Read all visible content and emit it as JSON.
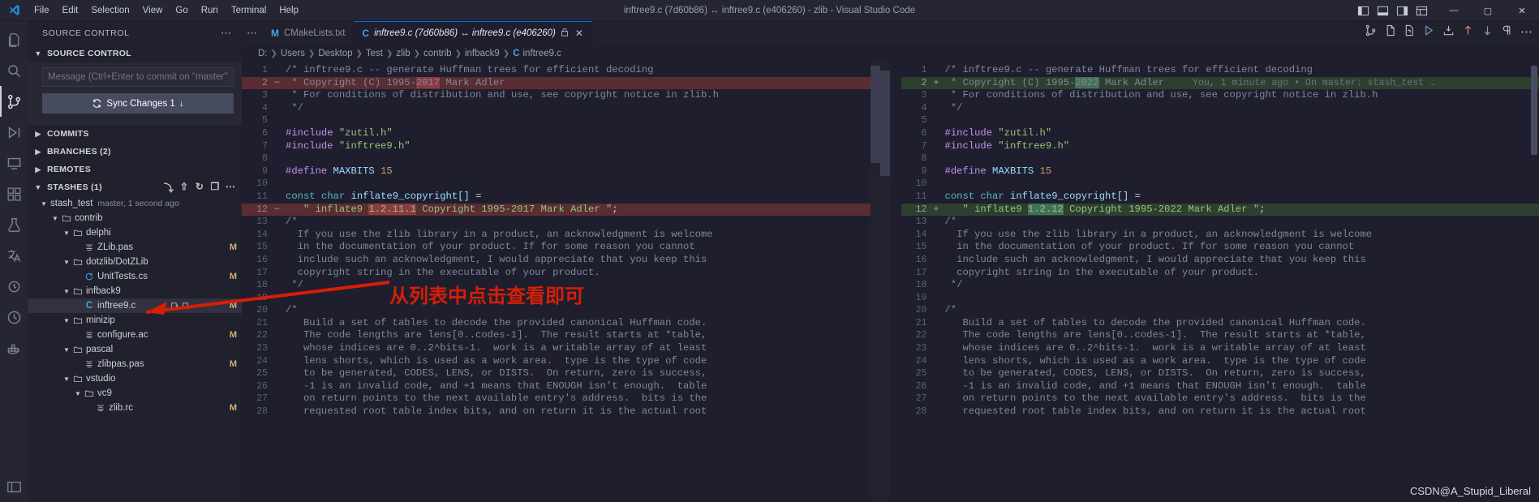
{
  "window": {
    "title": "inftree9.c (7d60b86) ↔ inftree9.c (e406260) - zlib - Visual Studio Code",
    "minimize": "—",
    "maximize": "▢",
    "close": "✕"
  },
  "menu": [
    "File",
    "Edit",
    "Selection",
    "View",
    "Go",
    "Run",
    "Terminal",
    "Help"
  ],
  "activitybar": [
    {
      "name": "explorer",
      "icon": "files-icon"
    },
    {
      "name": "search",
      "icon": "search-icon"
    },
    {
      "name": "source-control",
      "icon": "source-control-icon"
    },
    {
      "name": "run-debug",
      "icon": "run-debug-icon"
    },
    {
      "name": "remote-explorer",
      "icon": "remote-explorer-icon"
    },
    {
      "name": "extensions",
      "icon": "extensions-icon"
    },
    {
      "name": "testing",
      "icon": "beaker-icon"
    },
    {
      "name": "translate",
      "icon": "translate-icon"
    },
    {
      "name": "settings-sync",
      "icon": "sync-settings-icon"
    },
    {
      "name": "timeline",
      "icon": "clock-icon"
    },
    {
      "name": "docker",
      "icon": "docker-icon"
    },
    {
      "name": "layout",
      "icon": "layout-icon"
    }
  ],
  "sidebar": {
    "header": "SOURCE CONTROL",
    "more_actions": "⋯",
    "scm": {
      "section_label": "SOURCE CONTROL",
      "commit_placeholder": "Message (Ctrl+Enter to commit on \"master\")",
      "commit_value": "",
      "sync_label": "Sync Changes 1",
      "sync_arrow": "↓"
    },
    "sections": [
      {
        "label": "COMMITS",
        "expanded": false
      },
      {
        "label": "BRANCHES (2)",
        "expanded": false
      },
      {
        "label": "REMOTES",
        "expanded": false
      },
      {
        "label": "STASHES (1)",
        "expanded": true
      }
    ],
    "stash": {
      "name": "stash_test",
      "desc": "master, 1 second ago"
    },
    "tree": [
      {
        "indent": 1,
        "type": "folder",
        "label": "contrib",
        "badge": "",
        "expanded": true,
        "selected": false
      },
      {
        "indent": 2,
        "type": "folder",
        "label": "delphi",
        "badge": "",
        "expanded": true,
        "selected": false
      },
      {
        "indent": 3,
        "type": "pas",
        "label": "ZLib.pas",
        "badge": "M",
        "expanded": null,
        "selected": false
      },
      {
        "indent": 2,
        "type": "folder",
        "label": "dotzlib/DotZLib",
        "badge": "",
        "expanded": true,
        "selected": false
      },
      {
        "indent": 3,
        "type": "cs",
        "label": "UnitTests.cs",
        "badge": "M",
        "expanded": null,
        "selected": false
      },
      {
        "indent": 2,
        "type": "folder",
        "label": "infback9",
        "badge": "",
        "expanded": true,
        "selected": false
      },
      {
        "indent": 3,
        "type": "c",
        "label": "inftree9.c",
        "badge": "M",
        "expanded": null,
        "selected": true
      },
      {
        "indent": 2,
        "type": "folder",
        "label": "minizip",
        "badge": "",
        "expanded": true,
        "selected": false
      },
      {
        "indent": 3,
        "type": "pas",
        "label": "configure.ac",
        "badge": "M",
        "expanded": null,
        "selected": false
      },
      {
        "indent": 2,
        "type": "folder",
        "label": "pascal",
        "badge": "",
        "expanded": true,
        "selected": false
      },
      {
        "indent": 3,
        "type": "pas",
        "label": "zlibpas.pas",
        "badge": "M",
        "expanded": null,
        "selected": false
      },
      {
        "indent": 2,
        "type": "folder",
        "label": "vstudio",
        "badge": "",
        "expanded": true,
        "selected": false
      },
      {
        "indent": 3,
        "type": "folder",
        "label": "vc9",
        "badge": "",
        "expanded": true,
        "selected": false
      },
      {
        "indent": 4,
        "type": "pas",
        "label": "zlib.rc",
        "badge": "M",
        "expanded": null,
        "selected": false
      }
    ]
  },
  "tabs": [
    {
      "label": "CMakeLists.txt",
      "icon": "M",
      "active": false,
      "italic": false
    },
    {
      "label": "inftree9.c (7d60b86) ↔ inftree9.c (e406260)",
      "icon": "C",
      "active": true,
      "italic": true,
      "lock": "🔒",
      "close": "✕"
    }
  ],
  "breadcrumbs": [
    "D:",
    "Users",
    "Desktop",
    "Test",
    "zlib",
    "contrib",
    "infback9"
  ],
  "breadcrumb_file": "inftree9.c",
  "breadcrumb_file_icon": "C",
  "editor_actions": [
    "compare-changes-icon",
    "open-file-icon",
    "revert-file-icon",
    "run-icon",
    "stage-icon",
    "previous-change-icon",
    "next-change-icon",
    "whitespace-icon",
    "more-actions-icon"
  ],
  "diff": {
    "left": [
      {
        "n": "1",
        "sign": "",
        "state": "",
        "text": "/* inftree9.c -- generate Huffman trees for efficient decoding",
        "cls": "cm"
      },
      {
        "n": "2",
        "sign": "−",
        "state": "del",
        "text": " * Copyright (C) 1995-2017 Mark Adler",
        "cls": "cm",
        "hl": "2017"
      },
      {
        "n": "3",
        "sign": "",
        "state": "",
        "text": " * For conditions of distribution and use, see copyright notice in zlib.h",
        "cls": "cm"
      },
      {
        "n": "4",
        "sign": "",
        "state": "",
        "text": " */",
        "cls": "cm"
      },
      {
        "n": "5",
        "sign": "",
        "state": "",
        "text": "",
        "cls": ""
      },
      {
        "n": "6",
        "sign": "",
        "state": "",
        "text": "#include \"zutil.h\"",
        "cls": "inc"
      },
      {
        "n": "7",
        "sign": "",
        "state": "",
        "text": "#include \"inftree9.h\"",
        "cls": "inc"
      },
      {
        "n": "8",
        "sign": "",
        "state": "",
        "text": "",
        "cls": ""
      },
      {
        "n": "9",
        "sign": "",
        "state": "",
        "text": "#define MAXBITS 15",
        "cls": "def"
      },
      {
        "n": "10",
        "sign": "",
        "state": "",
        "text": "",
        "cls": ""
      },
      {
        "n": "11",
        "sign": "",
        "state": "",
        "text": "const char inflate9_copyright[] =",
        "cls": "decl"
      },
      {
        "n": "12",
        "sign": "−",
        "state": "del",
        "text": "   \" inflate9 1.2.11.1 Copyright 1995-2017 Mark Adler \";",
        "cls": "strline",
        "hl": "1.2.11.1"
      },
      {
        "n": "13",
        "sign": "",
        "state": "",
        "text": "/*",
        "cls": "cm"
      },
      {
        "n": "14",
        "sign": "",
        "state": "",
        "text": "  If you use the zlib library in a product, an acknowledgment is welcome",
        "cls": "cm"
      },
      {
        "n": "15",
        "sign": "",
        "state": "",
        "text": "  in the documentation of your product. If for some reason you cannot",
        "cls": "cm"
      },
      {
        "n": "16",
        "sign": "",
        "state": "",
        "text": "  include such an acknowledgment, I would appreciate that you keep this",
        "cls": "cm"
      },
      {
        "n": "17",
        "sign": "",
        "state": "",
        "text": "  copyright string in the executable of your product.",
        "cls": "cm"
      },
      {
        "n": "18",
        "sign": "",
        "state": "",
        "text": " */",
        "cls": "cm"
      },
      {
        "n": "19",
        "sign": "",
        "state": "",
        "text": "",
        "cls": ""
      },
      {
        "n": "20",
        "sign": "",
        "state": "",
        "text": "/*",
        "cls": "cm"
      },
      {
        "n": "21",
        "sign": "",
        "state": "",
        "text": "   Build a set of tables to decode the provided canonical Huffman code.",
        "cls": "cm"
      },
      {
        "n": "22",
        "sign": "",
        "state": "",
        "text": "   The code lengths are lens[0..codes-1].  The result starts at *table,",
        "cls": "cm"
      },
      {
        "n": "23",
        "sign": "",
        "state": "",
        "text": "   whose indices are 0..2^bits-1.  work is a writable array of at least",
        "cls": "cm"
      },
      {
        "n": "24",
        "sign": "",
        "state": "",
        "text": "   lens shorts, which is used as a work area.  type is the type of code",
        "cls": "cm"
      },
      {
        "n": "25",
        "sign": "",
        "state": "",
        "text": "   to be generated, CODES, LENS, or DISTS.  On return, zero is success,",
        "cls": "cm"
      },
      {
        "n": "26",
        "sign": "",
        "state": "",
        "text": "   -1 is an invalid code, and +1 means that ENOUGH isn't enough.  table",
        "cls": "cm"
      },
      {
        "n": "27",
        "sign": "",
        "state": "",
        "text": "   on return points to the next available entry's address.  bits is the",
        "cls": "cm"
      },
      {
        "n": "28",
        "sign": "",
        "state": "",
        "text": "   requested root table index bits, and on return it is the actual root",
        "cls": "cm"
      }
    ],
    "right": [
      {
        "n": "1",
        "sign": "",
        "state": "",
        "text": "/* inftree9.c -- generate Huffman trees for efficient decoding",
        "cls": "cm"
      },
      {
        "n": "2",
        "sign": "+",
        "state": "add",
        "text": " * Copyright (C) 1995-2022 Mark Adler",
        "cls": "cm",
        "hl": "2022",
        "blame": "You, 1 minute ago • On master: stash_test …"
      },
      {
        "n": "3",
        "sign": "",
        "state": "",
        "text": " * For conditions of distribution and use, see copyright notice in zlib.h",
        "cls": "cm"
      },
      {
        "n": "4",
        "sign": "",
        "state": "",
        "text": " */",
        "cls": "cm"
      },
      {
        "n": "5",
        "sign": "",
        "state": "",
        "text": "",
        "cls": ""
      },
      {
        "n": "6",
        "sign": "",
        "state": "",
        "text": "#include \"zutil.h\"",
        "cls": "inc"
      },
      {
        "n": "7",
        "sign": "",
        "state": "",
        "text": "#include \"inftree9.h\"",
        "cls": "inc"
      },
      {
        "n": "8",
        "sign": "",
        "state": "",
        "text": "",
        "cls": ""
      },
      {
        "n": "9",
        "sign": "",
        "state": "",
        "text": "#define MAXBITS 15",
        "cls": "def"
      },
      {
        "n": "10",
        "sign": "",
        "state": "",
        "text": "",
        "cls": ""
      },
      {
        "n": "11",
        "sign": "",
        "state": "",
        "text": "const char inflate9_copyright[] =",
        "cls": "decl"
      },
      {
        "n": "12",
        "sign": "+",
        "state": "add",
        "text": "   \" inflate9 1.2.12 Copyright 1995-2022 Mark Adler \";",
        "cls": "strline",
        "hl": "1.2.12"
      },
      {
        "n": "13",
        "sign": "",
        "state": "",
        "text": "/*",
        "cls": "cm"
      },
      {
        "n": "14",
        "sign": "",
        "state": "",
        "text": "  If you use the zlib library in a product, an acknowledgment is welcome",
        "cls": "cm"
      },
      {
        "n": "15",
        "sign": "",
        "state": "",
        "text": "  in the documentation of your product. If for some reason you cannot",
        "cls": "cm"
      },
      {
        "n": "16",
        "sign": "",
        "state": "",
        "text": "  include such an acknowledgment, I would appreciate that you keep this",
        "cls": "cm"
      },
      {
        "n": "17",
        "sign": "",
        "state": "",
        "text": "  copyright string in the executable of your product.",
        "cls": "cm"
      },
      {
        "n": "18",
        "sign": "",
        "state": "",
        "text": " */",
        "cls": "cm"
      },
      {
        "n": "19",
        "sign": "",
        "state": "",
        "text": "",
        "cls": ""
      },
      {
        "n": "20",
        "sign": "",
        "state": "",
        "text": "/*",
        "cls": "cm"
      },
      {
        "n": "21",
        "sign": "",
        "state": "",
        "text": "   Build a set of tables to decode the provided canonical Huffman code.",
        "cls": "cm"
      },
      {
        "n": "22",
        "sign": "",
        "state": "",
        "text": "   The code lengths are lens[0..codes-1].  The result starts at *table,",
        "cls": "cm"
      },
      {
        "n": "23",
        "sign": "",
        "state": "",
        "text": "   whose indices are 0..2^bits-1.  work is a writable array of at least",
        "cls": "cm"
      },
      {
        "n": "24",
        "sign": "",
        "state": "",
        "text": "   lens shorts, which is used as a work area.  type is the type of code",
        "cls": "cm"
      },
      {
        "n": "25",
        "sign": "",
        "state": "",
        "text": "   to be generated, CODES, LENS, or DISTS.  On return, zero is success,",
        "cls": "cm"
      },
      {
        "n": "26",
        "sign": "",
        "state": "",
        "text": "   -1 is an invalid code, and +1 means that ENOUGH isn't enough.  table",
        "cls": "cm"
      },
      {
        "n": "27",
        "sign": "",
        "state": "",
        "text": "   on return points to the next available entry's address.  bits is the",
        "cls": "cm"
      },
      {
        "n": "28",
        "sign": "",
        "state": "",
        "text": "   requested root table index bits, and on return it is the actual root",
        "cls": "cm"
      }
    ]
  },
  "annotation": {
    "text": "从列表中点击查看即可",
    "color": "#d81e06"
  },
  "watermark": "CSDN@A_Stupid_Liberal",
  "colors": {
    "accent": "#0078d4",
    "added": "#2d402f",
    "deleted": "#5a2d33",
    "annotation": "#d81e06"
  }
}
